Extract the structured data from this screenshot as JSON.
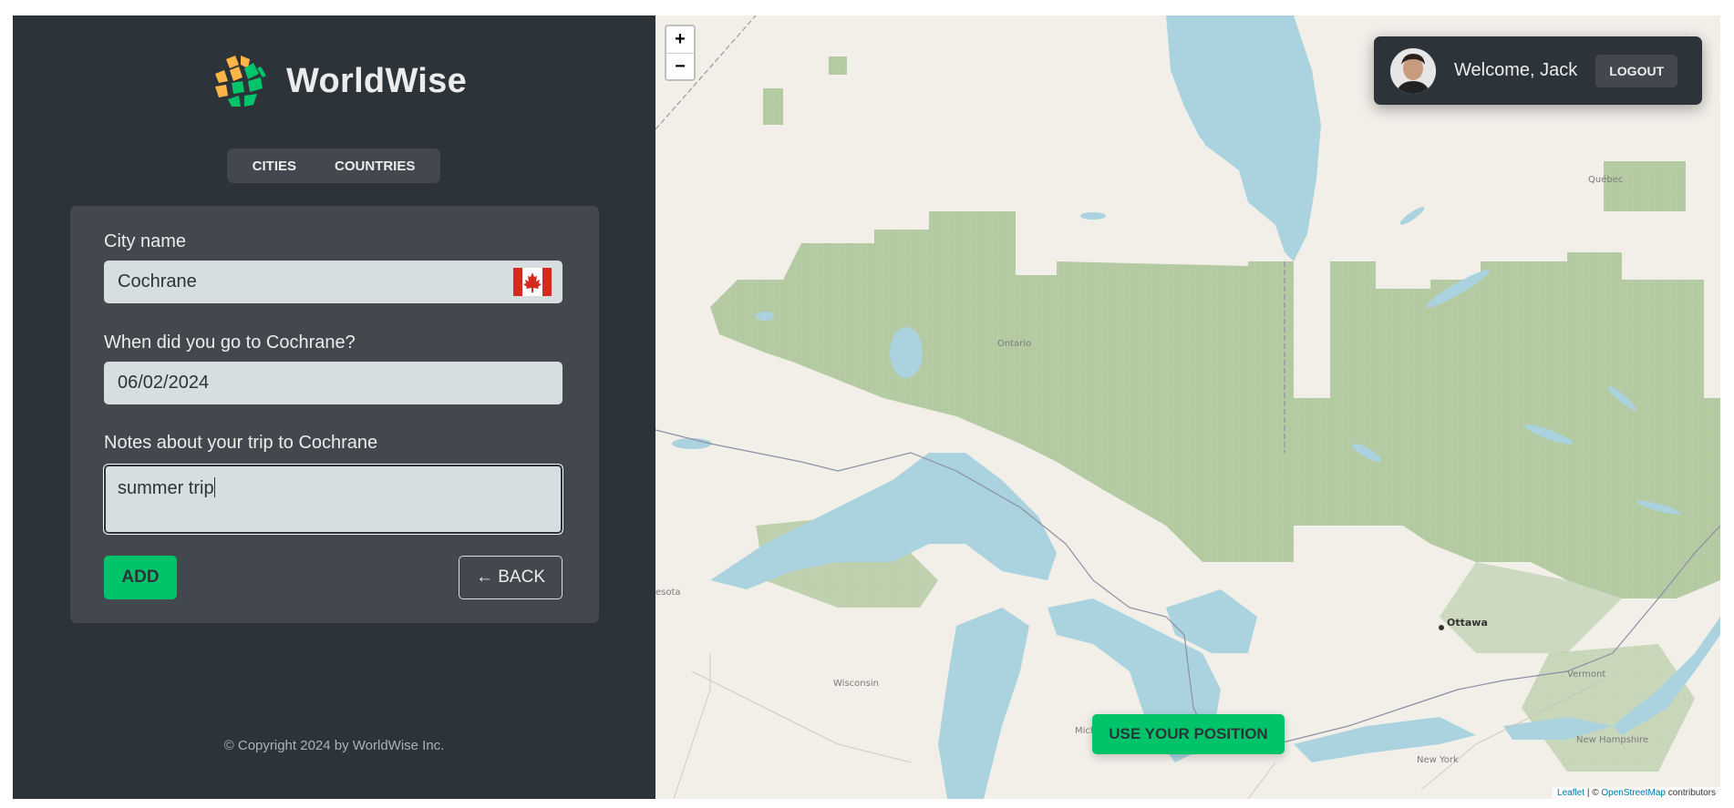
{
  "brand": {
    "name": "WorldWise"
  },
  "nav": {
    "tabs": [
      "CITIES",
      "COUNTRIES"
    ]
  },
  "form": {
    "city_label": "City name",
    "city_value": "Cochrane",
    "flag": "Canada flag",
    "date_label": "When did you go to Cochrane?",
    "date_value": "06/02/2024",
    "notes_label": "Notes about your trip to Cochrane",
    "notes_value": "summer trip",
    "add_label": "ADD",
    "back_label": "← BACK"
  },
  "footer": {
    "copyright": "© Copyright 2024 by WorldWise Inc."
  },
  "user": {
    "welcome": "Welcome, Jack",
    "logout_label": "LOGOUT"
  },
  "map": {
    "zoom_in": "+",
    "zoom_out": "−",
    "position_button": "USE YOUR POSITION",
    "labels": {
      "quebec": "Québec",
      "ontario": "Ontario",
      "ottawa": "Ottawa",
      "minnesota": "esota",
      "wisconsin": "Wisconsin",
      "michigan": "Michigan",
      "vermont": "Vermont",
      "new_hampshire": "New Hampshire",
      "new_york": "New York"
    },
    "attribution": {
      "leaflet": "Leaflet",
      "separator": " | © ",
      "osm": "OpenStreetMap",
      "contributors": " contributors"
    }
  },
  "colors": {
    "sidebar_bg": "#2d3439",
    "panel_bg": "#42484d",
    "input_bg": "#d6dee0",
    "accent": "#00c46a",
    "water": "#aad3df",
    "forest": "#add19e",
    "land": "#f2efe9"
  }
}
